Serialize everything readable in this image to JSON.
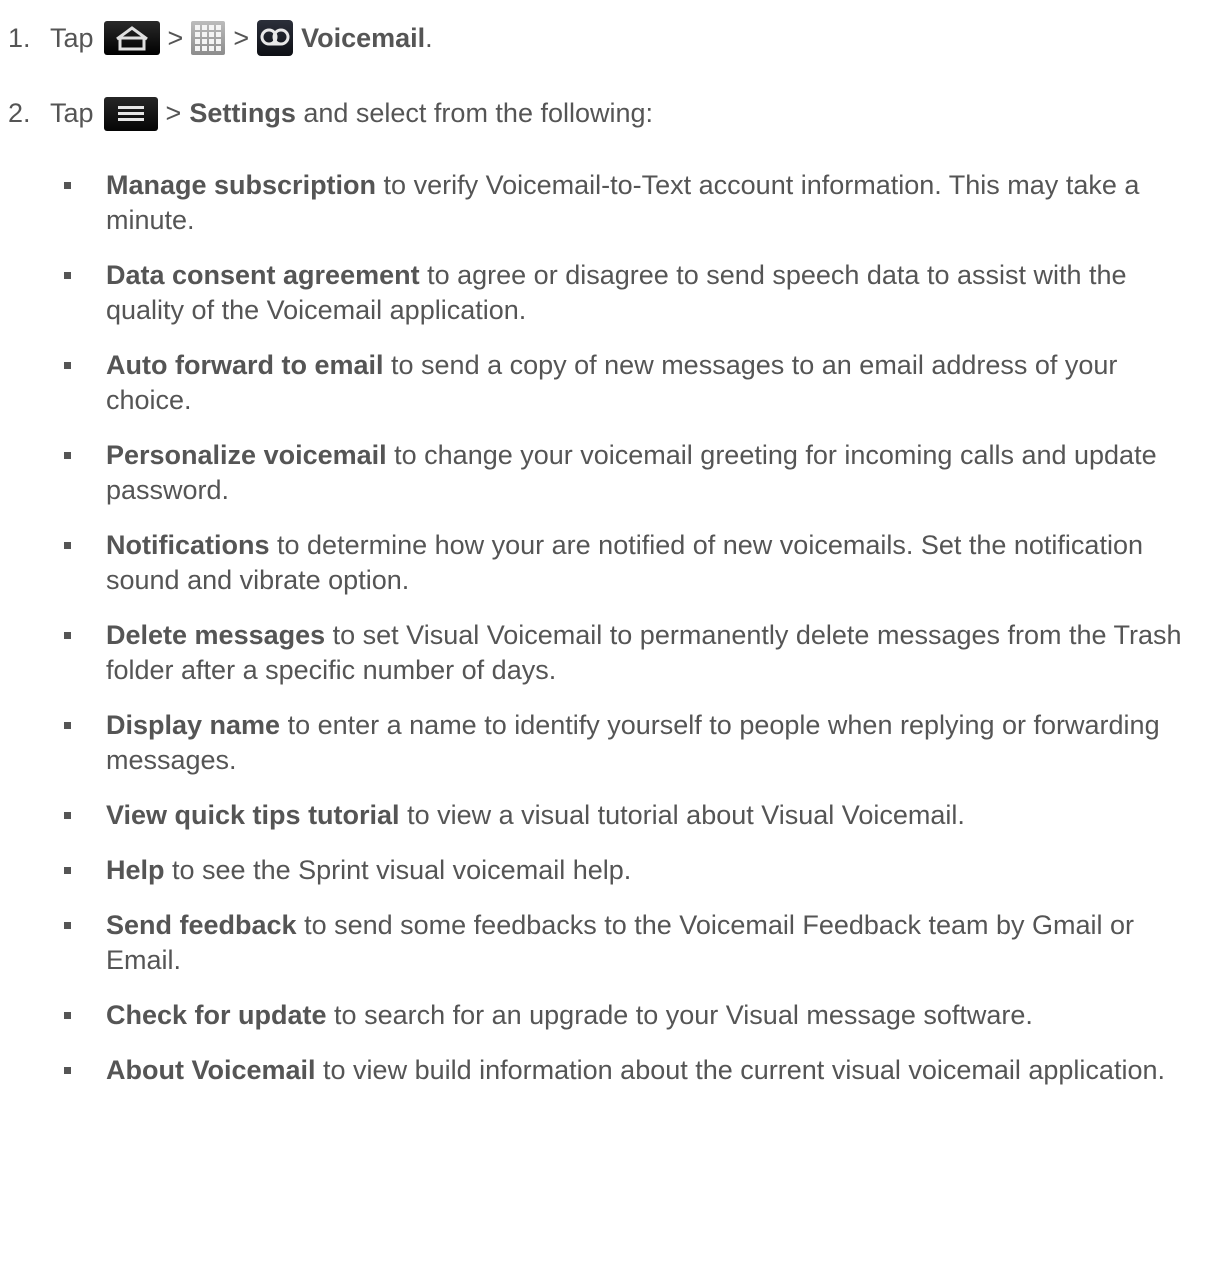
{
  "steps": [
    {
      "number": "1.",
      "prefix": "Tap",
      "separator": ">",
      "icons": [
        "home-icon",
        "apps-icon",
        "voicemail-icon"
      ],
      "bold_end": "Voicemail",
      "period": "."
    },
    {
      "number": "2.",
      "prefix": "Tap",
      "separator": ">",
      "icons": [
        "menu-icon"
      ],
      "bold": "Settings",
      "suffix": " and select from the following:"
    }
  ],
  "options": [
    {
      "bold": "Manage subscription",
      "text": " to verify Voicemail-to-Text account information. This may take a minute."
    },
    {
      "bold": "Data consent agreement",
      "text": " to agree or disagree to send speech data to assist with the quality of the Voicemail application."
    },
    {
      "bold": "Auto forward to email",
      "text": " to send a copy of new messages to an email address of your choice."
    },
    {
      "bold": "Personalize voicemail",
      "text": " to change your voicemail greeting for incoming calls and update password."
    },
    {
      "bold": "Notifications",
      "text": " to determine how your are notified of new voicemails. Set the notification sound and vibrate option."
    },
    {
      "bold": "Delete messages",
      "text": " to set Visual Voicemail to permanently delete messages from the Trash folder after a specific number of days."
    },
    {
      "bold": "Display name",
      "text": " to enter a name to identify yourself to people when replying or forwarding messages."
    },
    {
      "bold": "View quick tips tutorial",
      "text": " to view a visual tutorial about Visual Voicemail."
    },
    {
      "bold": "Help",
      "text": " to see the Sprint visual voicemail help."
    },
    {
      "bold": "Send feedback",
      "text": " to send some feedbacks to the Voicemail Feedback team by Gmail or Email."
    },
    {
      "bold": "Check for update",
      "text": " to search for an upgrade to your Visual message software."
    },
    {
      "bold": "About Voicemail",
      "text": " to view build information about the current visual voicemail application."
    }
  ]
}
